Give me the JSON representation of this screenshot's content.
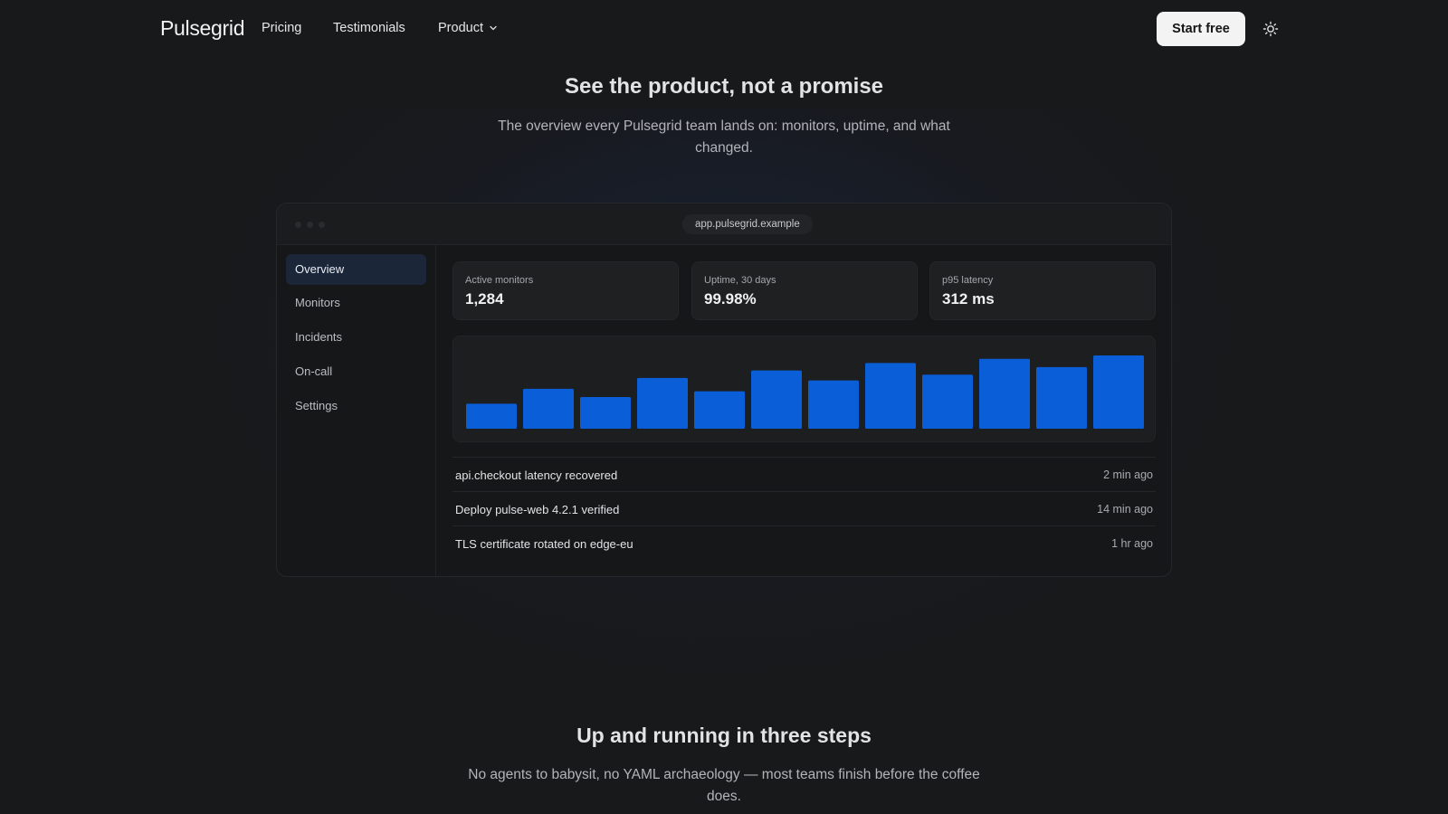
{
  "nav": {
    "logo": "Pulsegrid",
    "links": [
      "Pricing",
      "Testimonials",
      "Product"
    ],
    "cta": "Start free"
  },
  "hero": {
    "title": "See the product, not a promise",
    "subtitle": "The overview every Pulsegrid team lands on: monitors, uptime, and what changed."
  },
  "app": {
    "url": "app.pulsegrid.example",
    "sidebar": [
      "Overview",
      "Monitors",
      "Incidents",
      "On-call",
      "Settings"
    ],
    "active_sidebar": "Overview",
    "stats": [
      {
        "label": "Active monitors",
        "value": "1,284"
      },
      {
        "label": "Uptime, 30 days",
        "value": "99.98%"
      },
      {
        "label": "p95 latency",
        "value": "312 ms"
      }
    ],
    "events": [
      {
        "text": "api.checkout latency recovered",
        "time": "2 min ago"
      },
      {
        "text": "Deploy pulse-web 4.2.1 verified",
        "time": "14 min ago"
      },
      {
        "text": "TLS certificate rotated on edge-eu",
        "time": "1 hr ago"
      }
    ]
  },
  "chart_data": {
    "type": "bar",
    "values": [
      30,
      48,
      38,
      61,
      45,
      70,
      58,
      79,
      65,
      84,
      74,
      88
    ],
    "ylim": [
      0,
      100
    ],
    "color": "#0a5fd8"
  },
  "section2": {
    "title": "Up and running in three steps",
    "subtitle": "No agents to babysit, no YAML archaeology — most teams finish before the coffee does."
  },
  "colors": {
    "background": "#18191b",
    "accent": "#0a5fd8",
    "cta_bg": "#f3f3f4"
  }
}
